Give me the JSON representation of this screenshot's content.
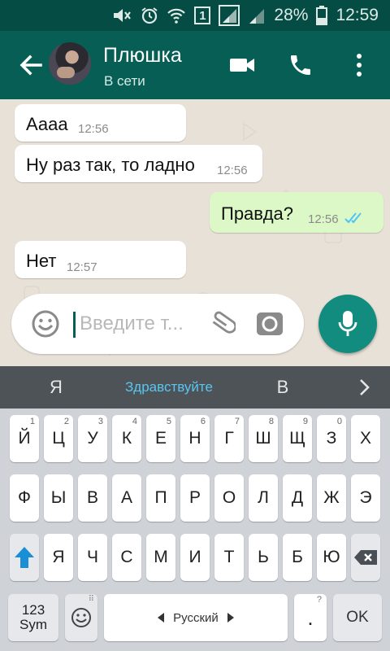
{
  "status_bar": {
    "battery": "28%",
    "time": "12:59",
    "sim": "1"
  },
  "header": {
    "contact_name": "Плюшка",
    "contact_status": "В сети"
  },
  "messages": [
    {
      "text": "Аааа",
      "time": "12:56",
      "direction": "in"
    },
    {
      "text": "Ну раз так, то ладно",
      "time": "12:56",
      "direction": "in"
    },
    {
      "text": "Правда?",
      "time": "12:56",
      "direction": "out",
      "read": true
    },
    {
      "text": "Нет",
      "time": "12:57",
      "direction": "in"
    }
  ],
  "composer": {
    "placeholder": "Введите т..."
  },
  "suggestions": [
    "Я",
    "Здравствуйте",
    "В"
  ],
  "keyboard": {
    "row1": [
      {
        "key": "Й",
        "hint": "1"
      },
      {
        "key": "Ц",
        "hint": "2"
      },
      {
        "key": "У",
        "hint": "3"
      },
      {
        "key": "К",
        "hint": "4"
      },
      {
        "key": "Е",
        "hint": "5"
      },
      {
        "key": "Н",
        "hint": "6"
      },
      {
        "key": "Г",
        "hint": "7"
      },
      {
        "key": "Ш",
        "hint": "8"
      },
      {
        "key": "Щ",
        "hint": "9"
      },
      {
        "key": "З",
        "hint": "0"
      },
      {
        "key": "Х",
        "hint": ""
      }
    ],
    "row2": [
      "Ф",
      "Ы",
      "В",
      "А",
      "П",
      "Р",
      "О",
      "Л",
      "Д",
      "Ж",
      "Э"
    ],
    "row3": [
      "Я",
      "Ч",
      "С",
      "М",
      "И",
      "Т",
      "Ь",
      "Б",
      "Ю"
    ],
    "sym_label_1": "123",
    "sym_label_2": "Sym",
    "space_label": "Русский",
    "period": ".",
    "ok_label": "OK"
  },
  "colors": {
    "header": "#075e54",
    "status_bar": "#054d44",
    "accent": "#128c7e",
    "outgoing_bubble": "#dcf8c6",
    "read_ticks": "#4fc3f7"
  }
}
